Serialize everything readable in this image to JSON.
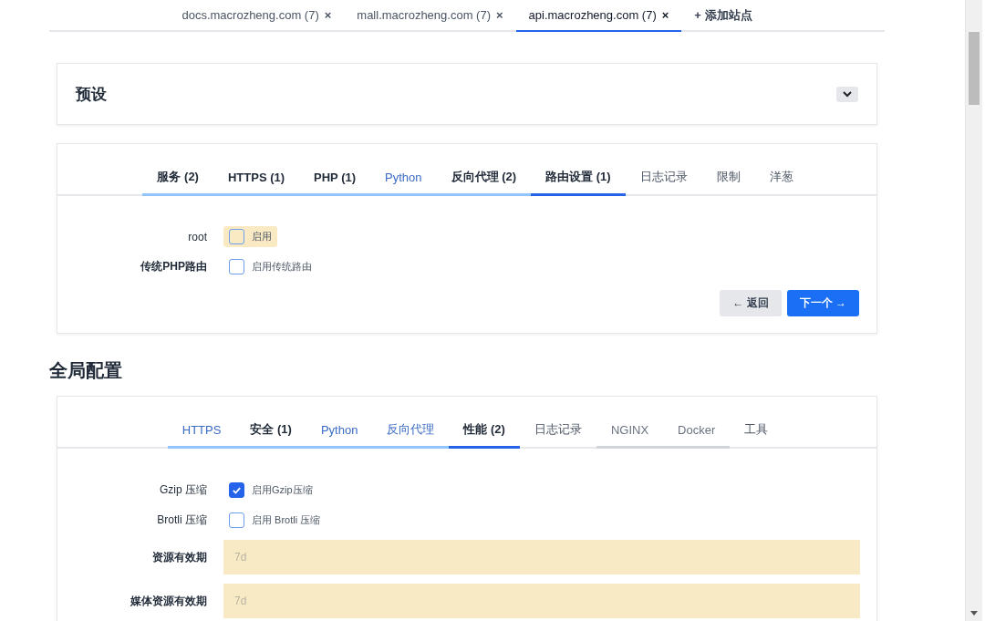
{
  "site_tabs": [
    {
      "label": "docs.macrozheng.com (7)",
      "close": "×",
      "selected": false
    },
    {
      "label": "mall.macrozheng.com (7)",
      "close": "×",
      "selected": false
    },
    {
      "label": "api.macrozheng.com (7)",
      "close": "×",
      "selected": true
    }
  ],
  "add_site": "+ 添加站点",
  "preset": {
    "title": "预设",
    "expanded": false
  },
  "site_config": {
    "tabs": [
      {
        "label": "服务 (2)",
        "kind": "modified",
        "selected": false
      },
      {
        "label": "HTTPS (1)",
        "kind": "modified",
        "selected": false
      },
      {
        "label": "PHP (1)",
        "kind": "modified",
        "selected": false
      },
      {
        "label": "Python",
        "kind": "enabled",
        "selected": false
      },
      {
        "label": "反向代理 (2)",
        "kind": "modified",
        "selected": false
      },
      {
        "label": "路由设置 (1)",
        "kind": "modified",
        "selected": true
      },
      {
        "label": "日志记录",
        "kind": "plain",
        "selected": false
      },
      {
        "label": "限制",
        "kind": "plain",
        "selected": false
      },
      {
        "label": "洋葱",
        "kind": "plain",
        "selected": false
      }
    ],
    "rows": [
      {
        "kind": "checkbox",
        "label": "root",
        "bold": false,
        "text": "启用",
        "checked": false,
        "highlighted": true
      },
      {
        "kind": "checkbox",
        "label": "传统PHP路由",
        "bold": true,
        "text": "启用传统路由",
        "checked": false,
        "highlighted": false
      }
    ],
    "back_button": "← 返回",
    "next_button": "下一个 →"
  },
  "global_heading": "全局配置",
  "global_config": {
    "tabs": [
      {
        "label": "HTTPS",
        "kind": "enabled",
        "selected": false
      },
      {
        "label": "安全 (1)",
        "kind": "modified",
        "selected": false
      },
      {
        "label": "Python",
        "kind": "enabled",
        "selected": false
      },
      {
        "label": "反向代理",
        "kind": "enabled",
        "selected": false
      },
      {
        "label": "性能 (2)",
        "kind": "modified",
        "selected": true
      },
      {
        "label": "日志记录",
        "kind": "plain",
        "selected": false
      },
      {
        "label": "NGINX",
        "kind": "inactive",
        "selected": false
      },
      {
        "label": "Docker",
        "kind": "inactive",
        "selected": false
      },
      {
        "label": "工具",
        "kind": "plain",
        "selected": false
      }
    ],
    "rows": [
      {
        "kind": "checkbox",
        "label": "Gzip 压缩",
        "bold": false,
        "text": "启用Gzip压缩",
        "checked": true,
        "highlighted": false
      },
      {
        "kind": "checkbox",
        "label": "Brotli 压缩",
        "bold": false,
        "text": "启用 Brotli 压缩",
        "checked": false,
        "highlighted": false
      },
      {
        "kind": "input",
        "label": "资源有效期",
        "bold": true,
        "placeholder": "7d",
        "highlighted": true
      },
      {
        "kind": "input",
        "label": "媒体资源有效期",
        "bold": true,
        "placeholder": "7d",
        "highlighted": true
      }
    ]
  }
}
